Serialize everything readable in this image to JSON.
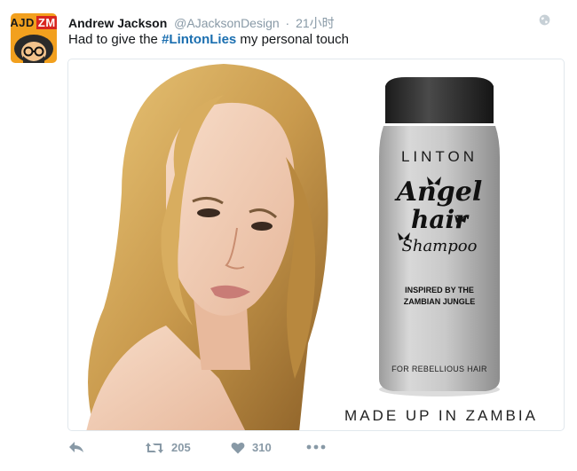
{
  "tweet": {
    "avatar_text_a": "AJD",
    "avatar_text_b": "ZM",
    "fullname": "Andrew Jackson",
    "username": "@AJacksonDesign",
    "separator": "·",
    "time": "21小时",
    "text_before": "Had to give the ",
    "hashtag": "#LintonLies",
    "text_after": " my personal touch"
  },
  "media": {
    "brand": "LINTON",
    "title_line1": "Angel",
    "title_line2": "hair",
    "title_line3": "Shampoo",
    "inspired": "INSPIRED BY THE ZAMBIAN JUNGLE",
    "tagline": "FOR REBELLIOUS HAIR",
    "caption": "MADE UP IN ZAMBIA"
  },
  "actions": {
    "retweet_count": "205",
    "like_count": "310"
  },
  "icons": {
    "avatar": "avatar-icon",
    "globe": "globe-icon",
    "reply": "reply-icon",
    "retweet": "retweet-icon",
    "like": "heart-icon",
    "more": "more-dots-icon"
  },
  "colors": {
    "hashtag": "#1b6fb0",
    "muted": "#8899a6",
    "avatar_bg": "#f2a01e",
    "avatar_zm": "#d8261f"
  }
}
